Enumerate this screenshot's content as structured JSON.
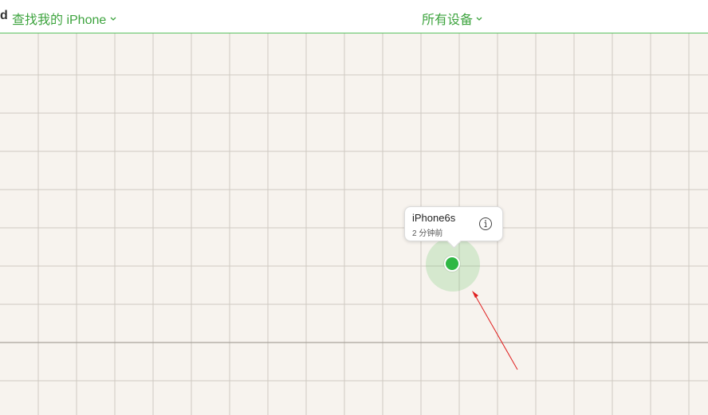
{
  "header": {
    "brand_fragment": "d",
    "app_title": "查找我的 iPhone",
    "device_filter": "所有设备"
  },
  "device": {
    "name": "iPhone6s",
    "last_seen": "2 分钟前",
    "info_icon": "info-icon",
    "status_color": "#2fb744"
  },
  "annotation": {
    "arrow_color": "#e02020"
  },
  "colors": {
    "accent": "#3ea43f",
    "map_bg": "#f7f3ee",
    "grid": "#cfc9c2"
  }
}
